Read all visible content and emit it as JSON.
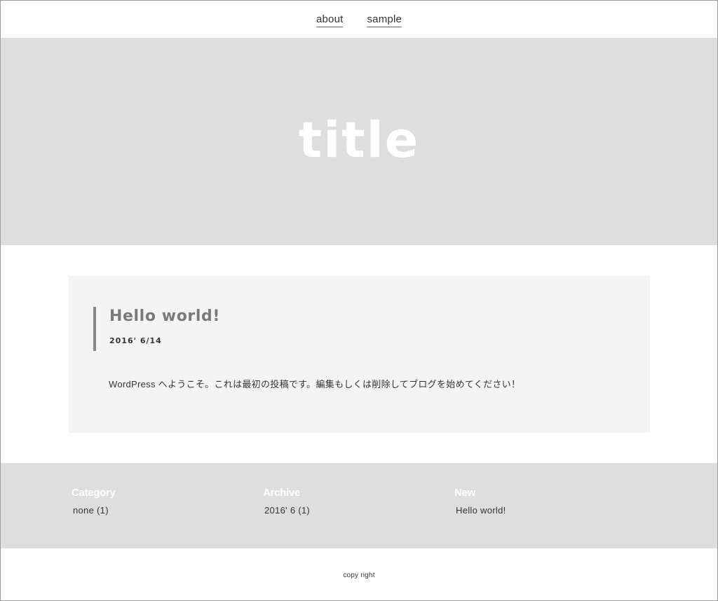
{
  "nav": {
    "items": [
      {
        "label": "about"
      },
      {
        "label": "sample"
      }
    ]
  },
  "hero": {
    "title": "title"
  },
  "post": {
    "title": "Hello world!",
    "date": "2016' 6/14",
    "body": "WordPress へようこそ。これは最初の投稿です。編集もしくは削除してブログを始めてください！"
  },
  "widgets": {
    "category": {
      "title": "Category",
      "items": [
        "none (1)"
      ]
    },
    "archive": {
      "title": "Archive",
      "items": [
        "2016' 6 (1)"
      ]
    },
    "new": {
      "title": "New",
      "items": [
        "Hello world!"
      ]
    }
  },
  "footer": {
    "copyright": "copy right"
  },
  "colors": {
    "hero_bg": "#dedede",
    "card_bg": "#f4f4f4",
    "accent_bar": "#888888",
    "title_gray": "#7a7a7a"
  }
}
